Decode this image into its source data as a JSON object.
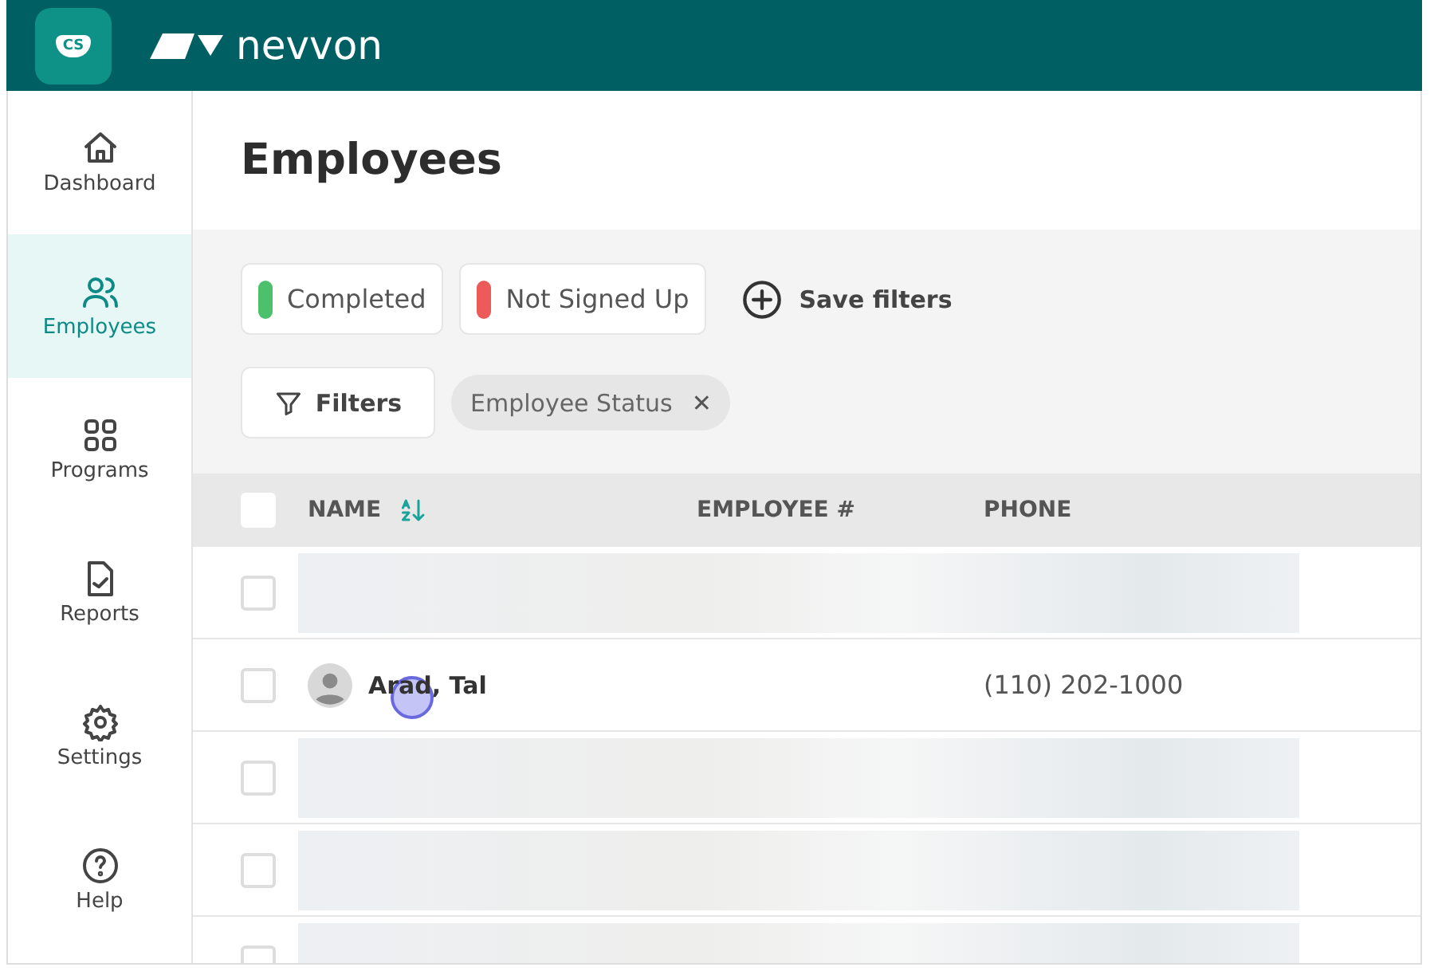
{
  "header": {
    "badge": "CS",
    "brand": "nevvon"
  },
  "sidebar": {
    "items": [
      {
        "label": "Dashboard",
        "selected": false
      },
      {
        "label": "Employees",
        "selected": true
      },
      {
        "label": "Programs",
        "selected": false
      },
      {
        "label": "Reports",
        "selected": false
      },
      {
        "label": "Settings",
        "selected": false
      },
      {
        "label": "Help",
        "selected": false
      }
    ]
  },
  "page": {
    "title": "Employees"
  },
  "status_chips": [
    {
      "label": "Completed",
      "color": "#4cc06a"
    },
    {
      "label": "Not Signed Up",
      "color": "#ec5a5a"
    }
  ],
  "save_filters": "Save filters",
  "filters_button": "Filters",
  "active_filters": [
    {
      "label": "Employee Status",
      "remove": "✕"
    }
  ],
  "table": {
    "select_all_checked": false,
    "columns": [
      "NAME",
      "EMPLOYEE #",
      "PHONE"
    ],
    "rows": [
      {
        "kind": "redacted",
        "checked": false
      },
      {
        "kind": "person",
        "checked": false,
        "name": "Arad, Tal",
        "employee_no": "",
        "phone": "(110) 202-1000",
        "click_marker": true
      },
      {
        "kind": "redacted",
        "checked": false
      },
      {
        "kind": "redacted",
        "checked": false
      },
      {
        "kind": "redacted",
        "checked": false
      }
    ]
  }
}
